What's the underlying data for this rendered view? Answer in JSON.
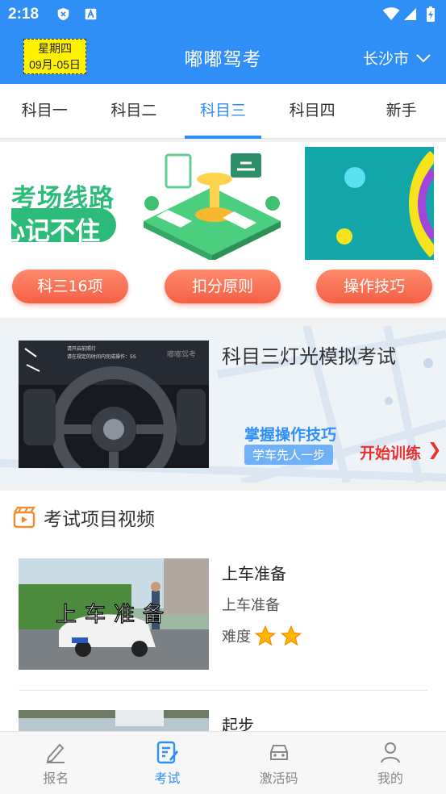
{
  "status_bar": {
    "time": "2:18"
  },
  "header": {
    "weekday": "星期四",
    "date": "09月-05日",
    "title": "嘟嘟驾考",
    "city": "长沙市"
  },
  "tabs": [
    {
      "label": "科目一",
      "active": false
    },
    {
      "label": "科目二",
      "active": false
    },
    {
      "label": "科目三",
      "active": true
    },
    {
      "label": "科目四",
      "active": false
    },
    {
      "label": "新手",
      "active": false
    }
  ],
  "quick_cards": {
    "route_line1": "考场线路",
    "route_line2": "心记不住",
    "pills": [
      "科三16项",
      "扣分原则",
      "操作技巧"
    ]
  },
  "light_sim": {
    "title": "科目三灯光模拟考试",
    "tag1": "掌握操作技巧",
    "tag2": "学车先人一步",
    "cta": "开始训练",
    "screen_line1": "请开启前照灯",
    "screen_line2": "请在规定的时间内完成操作：5S",
    "screen_brand": "嘟嘟驾考"
  },
  "videos": {
    "section_title": "考试项目视频",
    "difficulty_label": "难度",
    "items": [
      {
        "title": "上车准备",
        "subtitle": "上车准备",
        "stars": 2,
        "overlay": "上车准备"
      },
      {
        "title": "起步"
      }
    ]
  },
  "bottom_nav": [
    {
      "label": "报名",
      "icon": "pen-icon",
      "active": false
    },
    {
      "label": "考试",
      "icon": "exam-icon",
      "active": true
    },
    {
      "label": "激活码",
      "icon": "car-icon",
      "active": false
    },
    {
      "label": "我的",
      "icon": "user-icon",
      "active": false
    }
  ],
  "colors": {
    "primary": "#2f8ff7",
    "accent_orange": "#f56045",
    "date_badge": "#fff200",
    "cta_red": "#e8322e"
  }
}
